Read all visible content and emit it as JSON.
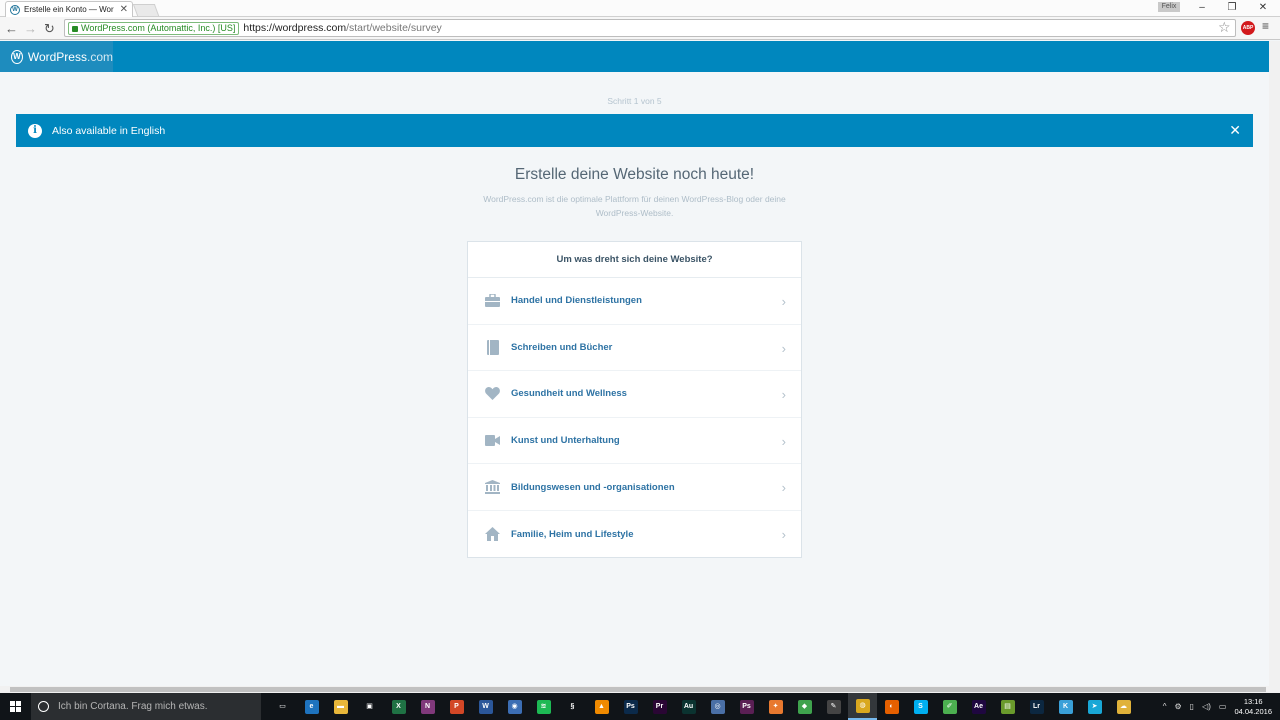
{
  "browser": {
    "tab_title": "Erstelle ein Konto — Wor",
    "tab_close": "✕",
    "user_chip": "Felix",
    "cert_label": "WordPress.com (Automattic, Inc.) [US]",
    "url_host": "https://wordpress.com",
    "url_path": "/start/website/survey",
    "window_controls": [
      "–",
      "❐",
      "✕"
    ]
  },
  "masterbar": {
    "brand_word": "WordPress",
    "brand_tld": ".com"
  },
  "step_text": "Schritt 1 von 5",
  "notice": {
    "text": "Also available in English",
    "info_glyph": "i",
    "close_glyph": "✕"
  },
  "headline": "Erstelle deine Website noch heute!",
  "subheadline": "WordPress.com ist die optimale Plattform für deinen WordPress-Blog oder deine WordPress-Website.",
  "survey": {
    "question": "Um was dreht sich deine Website?",
    "options": [
      {
        "label": "Handel und Dienstleistungen",
        "icon": "briefcase-icon"
      },
      {
        "label": "Schreiben und Bücher",
        "icon": "book-icon"
      },
      {
        "label": "Gesundheit und Wellness",
        "icon": "heart-icon"
      },
      {
        "label": "Kunst und Unterhaltung",
        "icon": "video-camera-icon"
      },
      {
        "label": "Bildungswesen und -organisationen",
        "icon": "institution-icon"
      },
      {
        "label": "Familie, Heim und Lifestyle",
        "icon": "house-icon"
      }
    ],
    "icon_color": "#a2b5c4",
    "label_color": "#2e73a4"
  },
  "taskbar": {
    "search_placeholder": "Ich bin Cortana. Frag mich etwas.",
    "apps": [
      {
        "name": "task-view",
        "glyph": "▭",
        "color": "#101418"
      },
      {
        "name": "edge",
        "glyph": "e",
        "color": "#1e73be"
      },
      {
        "name": "file-explorer",
        "glyph": "▬",
        "color": "#e8b73a"
      },
      {
        "name": "store",
        "glyph": "▣",
        "color": "#101418"
      },
      {
        "name": "excel",
        "glyph": "X",
        "color": "#1f7244"
      },
      {
        "name": "onenote",
        "glyph": "N",
        "color": "#80397b"
      },
      {
        "name": "powerpoint",
        "glyph": "P",
        "color": "#d24726"
      },
      {
        "name": "word",
        "glyph": "W",
        "color": "#2b579a"
      },
      {
        "name": "app-blue",
        "glyph": "◉",
        "color": "#3c6eb4"
      },
      {
        "name": "spotify",
        "glyph": "≋",
        "color": "#1db954"
      },
      {
        "name": "steam",
        "glyph": "§",
        "color": "#101418"
      },
      {
        "name": "vlc",
        "glyph": "▲",
        "color": "#f08a00"
      },
      {
        "name": "photoshop",
        "glyph": "Ps",
        "color": "#0b2a4a"
      },
      {
        "name": "premiere",
        "glyph": "Pr",
        "color": "#2a0634"
      },
      {
        "name": "audition",
        "glyph": "Au",
        "color": "#0b3330"
      },
      {
        "name": "app-ring",
        "glyph": "◎",
        "color": "#4a6fa5"
      },
      {
        "name": "app-ps-pink",
        "glyph": "Ps",
        "color": "#5a1f54"
      },
      {
        "name": "app-orange",
        "glyph": "✦",
        "color": "#e8792f"
      },
      {
        "name": "app-green",
        "glyph": "◆",
        "color": "#3fa34d"
      },
      {
        "name": "app-dark",
        "glyph": "✎",
        "color": "#444"
      },
      {
        "name": "chrome",
        "glyph": "◍",
        "color": "#d9a81f"
      },
      {
        "name": "firefox",
        "glyph": "◐",
        "color": "#e66000"
      },
      {
        "name": "skype",
        "glyph": "S",
        "color": "#00aff0"
      },
      {
        "name": "notes",
        "glyph": "✐",
        "color": "#4caf50"
      },
      {
        "name": "after-effects",
        "glyph": "Ae",
        "color": "#1f0740"
      },
      {
        "name": "app-yellow",
        "glyph": "▤",
        "color": "#6a9a2c"
      },
      {
        "name": "lightroom",
        "glyph": "Lr",
        "color": "#0c2740"
      },
      {
        "name": "app-k",
        "glyph": "K",
        "color": "#3aa0d8"
      },
      {
        "name": "app-cyan",
        "glyph": "➤",
        "color": "#19a7d6"
      },
      {
        "name": "app-cloud",
        "glyph": "☁",
        "color": "#e0b23a"
      }
    ],
    "tray_glyphs": [
      "^",
      "⚙",
      "▯",
      "◁)",
      "▭"
    ],
    "time": "13:16",
    "date": "04.04.2016"
  }
}
